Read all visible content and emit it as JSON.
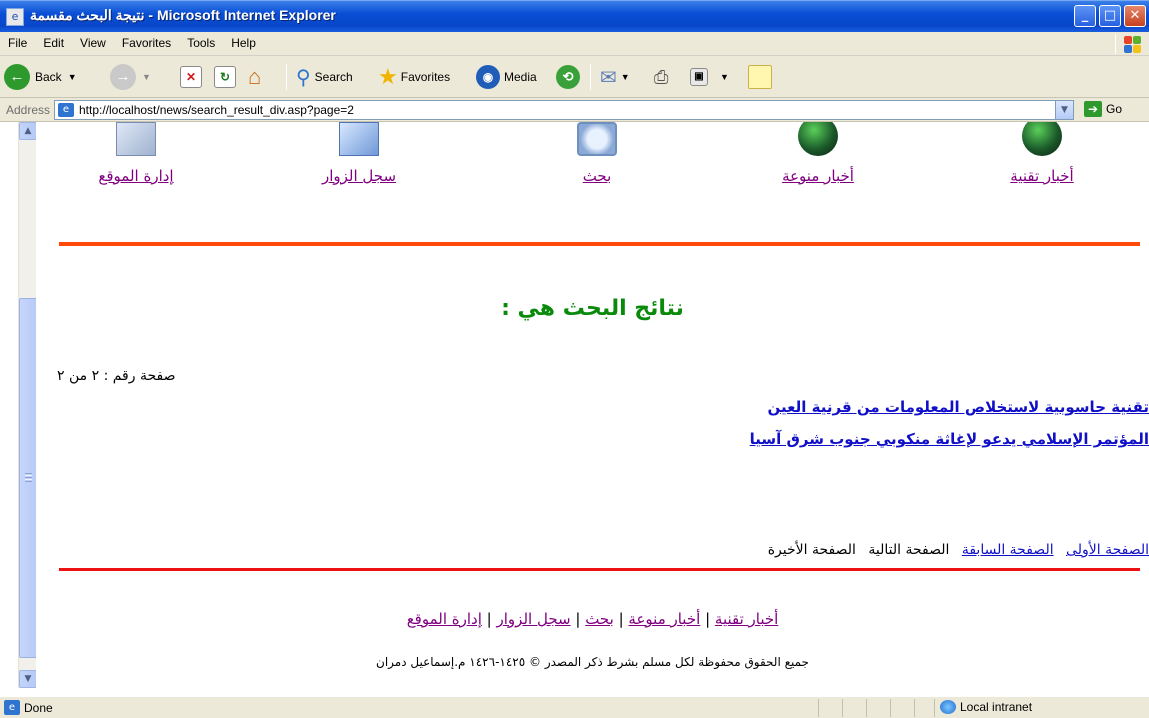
{
  "window": {
    "title": "نتيجة البحث مقسمة - Microsoft Internet Explorer"
  },
  "menu": [
    "File",
    "Edit",
    "View",
    "Favorites",
    "Tools",
    "Help"
  ],
  "toolbar": {
    "back": "Back",
    "search": "Search",
    "favorites": "Favorites",
    "media": "Media"
  },
  "address": {
    "label": "Address",
    "url": "http://localhost/news/search_result_div.asp?page=2",
    "go": "Go"
  },
  "nav": [
    {
      "label": "إدارة الموقع",
      "icon": "admin-tools-icon"
    },
    {
      "label": "سجل الزوار",
      "icon": "guestbook-icon"
    },
    {
      "label": "بحث",
      "icon": "search-magnifier-icon"
    },
    {
      "label": "أخبار منوعة",
      "icon": "globe-icon"
    },
    {
      "label": "أخبار تقنية",
      "icon": "tech-globe-icon"
    }
  ],
  "results": {
    "heading": "نتائج البحث هي :",
    "page_info": "صفحة رقم : ٢ من ٢",
    "items": [
      "تقنية حاسوبية لاستخلاص المعلومات من قرنية العين",
      "المؤتمر الإسلامي يدعو لإغاثة منكوبي جنوب شرق آسيا"
    ]
  },
  "pager": {
    "first": "الصفحة الأولى",
    "prev": "الصفحة السابقة",
    "next": "الصفحة التالية",
    "last": "الصفحة الأخيرة"
  },
  "footer": {
    "links": [
      "أخبار تقنية",
      "أخبار منوعة",
      "بحث",
      "سجل الزوار",
      "إدارة الموقع"
    ],
    "sep": "|",
    "copyright": "جميع الحقوق محفوظة لكل مسلم بشرط ذكر المصدر © ١٤٢٥-١٤٢٦ م.إسماعيل دمران"
  },
  "status": {
    "text": "Done",
    "zone": "Local intranet"
  },
  "colors": {
    "visited_link": "#800080",
    "result_link": "#1010c8",
    "heading": "#0a8a0a",
    "top_rule": "#ff4a0a",
    "bottom_rule": "#ee1111"
  }
}
